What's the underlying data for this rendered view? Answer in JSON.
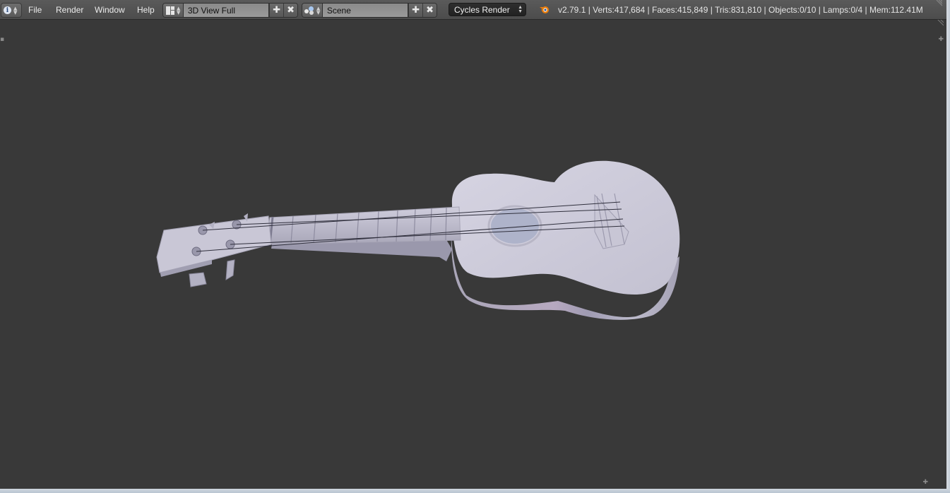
{
  "header": {
    "editor_type_icon": "info-icon",
    "menus": [
      "File",
      "Render",
      "Window",
      "Help"
    ],
    "screen_layout": {
      "icon": "screen-layout-icon",
      "value": "3D View Full",
      "add_icon": "plus-icon",
      "remove_icon": "x-icon"
    },
    "scene": {
      "icon": "scene-icon",
      "value": "Scene",
      "add_icon": "plus-icon",
      "remove_icon": "x-icon"
    },
    "render_engine": "Cycles Render",
    "stats": "v2.79.1 | Verts:417,684 | Faces:415,849 | Tris:831,810 | Objects:0/10 | Lamps:0/4 | Mem:112.41M"
  },
  "viewport": {
    "background": "#393939",
    "model": "ukulele",
    "model_color": "#c9c7d6"
  }
}
